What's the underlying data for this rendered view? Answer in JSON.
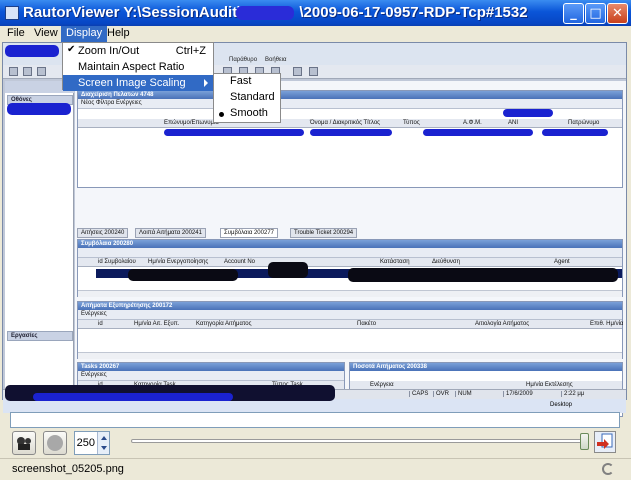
{
  "window": {
    "title": "RautorViewer Y:\\SessionAudit\\",
    "title_suffix": "\\2009-06-17-0957-RDP-Tcp#1532",
    "buttons": {
      "minimize": "_",
      "maximize": "□",
      "close": "✕"
    }
  },
  "menubar": {
    "file": "File",
    "view": "View",
    "display": "Display",
    "help": "Help"
  },
  "display_menu": {
    "zoom_label": "Zoom In/Out",
    "zoom_shortcut": "Ctrl+Z",
    "zoom_checked": true,
    "aspect_label": "Maintain Aspect Ratio",
    "scaling_label": "Screen Image Scaling"
  },
  "scaling_submenu": {
    "fast": "Fast",
    "standard": "Standard",
    "smooth": "Smooth",
    "selected": "Smooth"
  },
  "remote": {
    "menu": [
      "Παράθυρο",
      "Βοήθεια"
    ],
    "left_sections": {
      "top": "Οθόνες",
      "bottom": "Εργασίες"
    },
    "panel1": {
      "title": "Διαχείριση Πελατών 4748",
      "tools": "Νέος   Φίλτρα   Ενέργειες",
      "columns": [
        "Επώνυμο/Επωνυμία",
        "Όνομα / Διακριτικός Τίτλος",
        "Τύπος",
        "Α.Φ.Μ.",
        "ΑΝΙ",
        "Πατρώνυμο"
      ]
    },
    "tabs": [
      "Αιτήσεις 200240",
      "Λοιπά Αιτήματα 200241",
      "Συμβόλαια 200277",
      "Trouble Ticket 200294"
    ],
    "panel2": {
      "title": "Συμβόλαια 200280",
      "columns": [
        "id Συμβολαίου",
        "Ημ/νία Ενεργοποίησης",
        "Account No",
        "Κατάσταση",
        "Διεύθυνση",
        "Agent"
      ]
    },
    "panel3": {
      "title": "Αιτήματα Εξυπηρέτησης 200172",
      "tools": "Ενέργειες",
      "columns": [
        "id",
        "Ημ/νία Αιτ. Εξυπ.",
        "Κατηγορία Αιτήματος",
        "Πακέτο",
        "Αιτιολογία Αιτήματος",
        "Επιθ. Ημ/νία"
      ]
    },
    "panel4": {
      "title": "Tasks 200267",
      "tools": "Ενέργειες",
      "columns": [
        "id",
        "Κατηγορία Task",
        "Τύπος Task"
      ]
    },
    "panel5": {
      "title": "Ποσοτά Αιτήματος 200338",
      "columns": [
        "Ενέργεια",
        "Ημ/νία Εκτέλεσης"
      ]
    },
    "status": [
      "CAPS",
      "OVR",
      "NUM",
      "17/6/2009",
      "2:22 μμ"
    ],
    "taskbar_desktop": "Desktop"
  },
  "player": {
    "speed": "250",
    "filename": "screenshot_05205.png"
  }
}
